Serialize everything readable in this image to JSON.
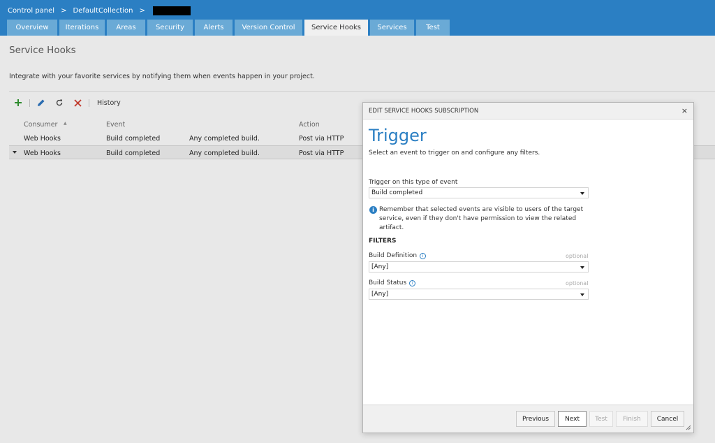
{
  "breadcrumb": {
    "root": "Control panel",
    "separator": ">",
    "collection": "DefaultCollection"
  },
  "tabs": [
    {
      "label": "Overview"
    },
    {
      "label": "Iterations"
    },
    {
      "label": "Areas"
    },
    {
      "label": "Security"
    },
    {
      "label": "Alerts"
    },
    {
      "label": "Version Control"
    },
    {
      "label": "Service Hooks"
    },
    {
      "label": "Services"
    },
    {
      "label": "Test"
    }
  ],
  "page": {
    "title": "Service Hooks",
    "description": "Integrate with your favorite services by notifying them when events happen in your project."
  },
  "toolbar": {
    "history_label": "History"
  },
  "grid": {
    "columns": {
      "consumer": "Consumer",
      "event": "Event",
      "action": "Action"
    },
    "rows": [
      {
        "consumer": "Web Hooks",
        "event": "Build completed",
        "description": "Any completed build.",
        "action": "Post via HTTP"
      },
      {
        "consumer": "Web Hooks",
        "event": "Build completed",
        "description": "Any completed build.",
        "action": "Post via HTTP"
      }
    ]
  },
  "dialog": {
    "title": "EDIT SERVICE HOOKS SUBSCRIPTION",
    "close": "×",
    "heading": "Trigger",
    "subheading": "Select an event to trigger on and configure any filters.",
    "event_type_label": "Trigger on this type of event",
    "event_type_value": "Build completed",
    "info_text": "Remember that selected events are visible to users of the target service, even if they don't have permission to view the related artifact.",
    "filters_title": "FILTERS",
    "build_definition_label": "Build Definition",
    "build_definition_optional": "optional",
    "build_definition_value": "[Any]",
    "build_status_label": "Build Status",
    "build_status_optional": "optional",
    "build_status_value": "[Any]",
    "buttons": {
      "previous": "Previous",
      "next": "Next",
      "test": "Test",
      "finish": "Finish",
      "cancel": "Cancel"
    }
  },
  "colors": {
    "header_blue": "#2b7fc3",
    "tab_blue": "#6aaad6",
    "add_green": "#2e8b2e",
    "delete_red": "#c0392b"
  }
}
